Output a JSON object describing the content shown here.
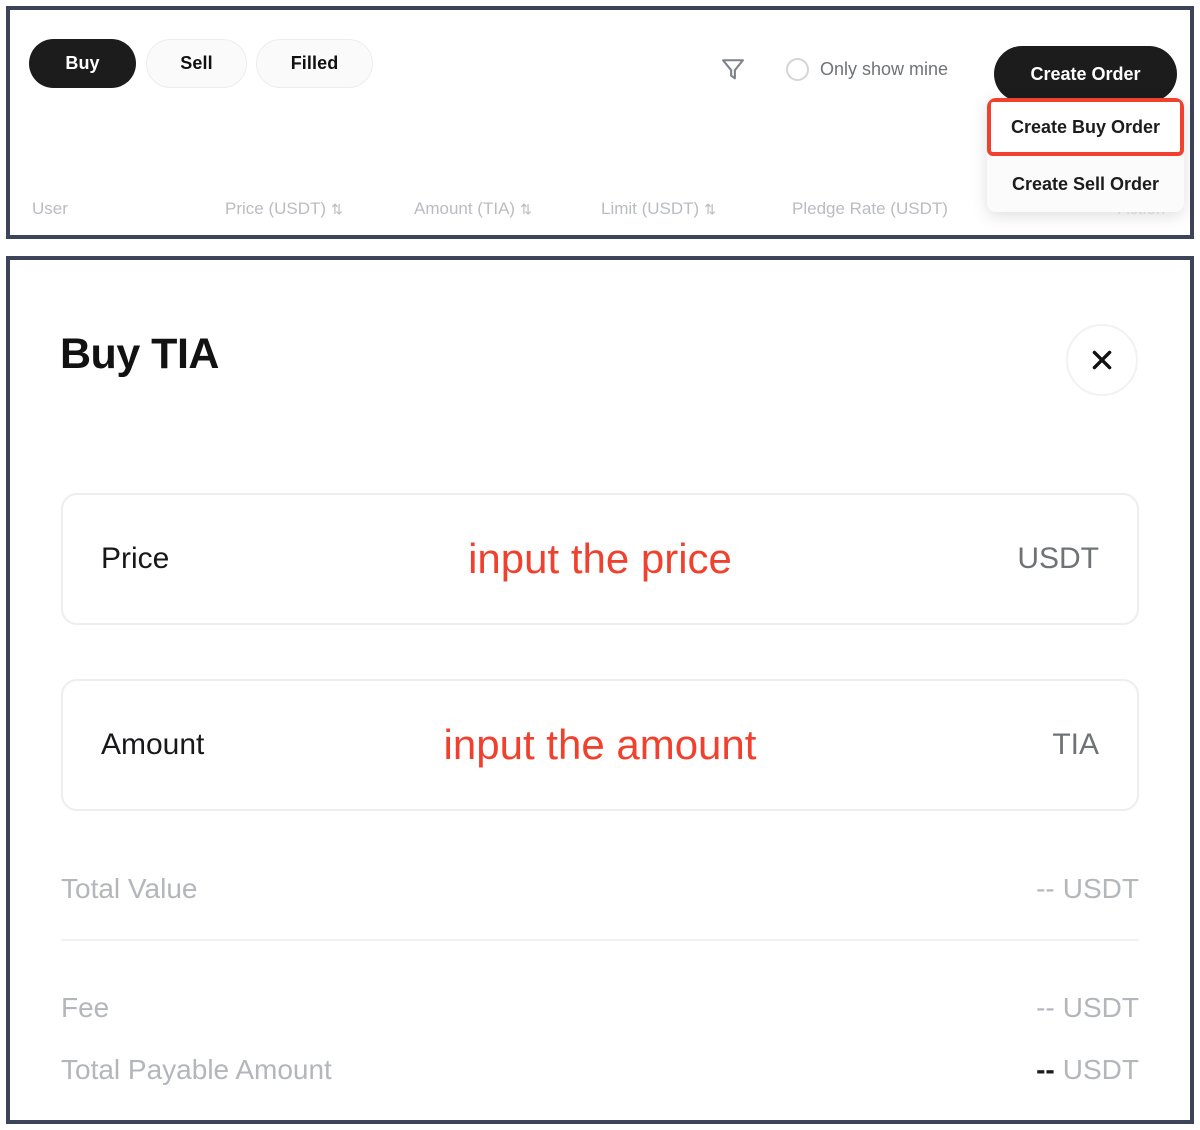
{
  "top_panel": {
    "tabs": [
      {
        "label": "Buy",
        "active": true
      },
      {
        "label": "Sell",
        "active": false
      },
      {
        "label": "Filled",
        "active": false
      }
    ],
    "filter_icon": "filter-funnel-icon",
    "only_show_mine": {
      "label": "Only show mine",
      "checked": false
    },
    "create_order_button": "Create Order",
    "dropdown": {
      "items": [
        {
          "label": "Create Buy Order",
          "highlighted": true
        },
        {
          "label": "Create Sell Order",
          "highlighted": false
        }
      ],
      "highlight_color": "#f0412f"
    },
    "table_headers": [
      {
        "label": "User",
        "sortable": false
      },
      {
        "label": "Price (USDT)",
        "sortable": true
      },
      {
        "label": "Amount (TIA)",
        "sortable": true
      },
      {
        "label": "Limit (USDT)",
        "sortable": true
      },
      {
        "label": "Pledge Rate (USDT)",
        "sortable": false
      },
      {
        "label": "Action",
        "sortable": false
      }
    ],
    "sort_glyph": "⇅"
  },
  "modal": {
    "title": "Buy TIA",
    "close_icon": "close-x-icon",
    "fields": [
      {
        "label": "Price",
        "placeholder": "input the price",
        "unit": "USDT",
        "value": ""
      },
      {
        "label": "Amount",
        "placeholder": "input the amount",
        "unit": "TIA",
        "value": ""
      }
    ],
    "summary": [
      {
        "label": "Total Value",
        "value": "--",
        "unit": "USDT",
        "emphasis": false
      },
      {
        "label": "Fee",
        "value": "--",
        "unit": "USDT",
        "emphasis": false
      },
      {
        "label": "Total Payable Amount",
        "value": "--",
        "unit": "USDT",
        "emphasis": true
      }
    ]
  },
  "colors": {
    "panel_border": "#3b4458",
    "accent_red": "#f0412f",
    "primary_dark": "#1c1c1c",
    "muted_text": "#b3b6ba"
  }
}
